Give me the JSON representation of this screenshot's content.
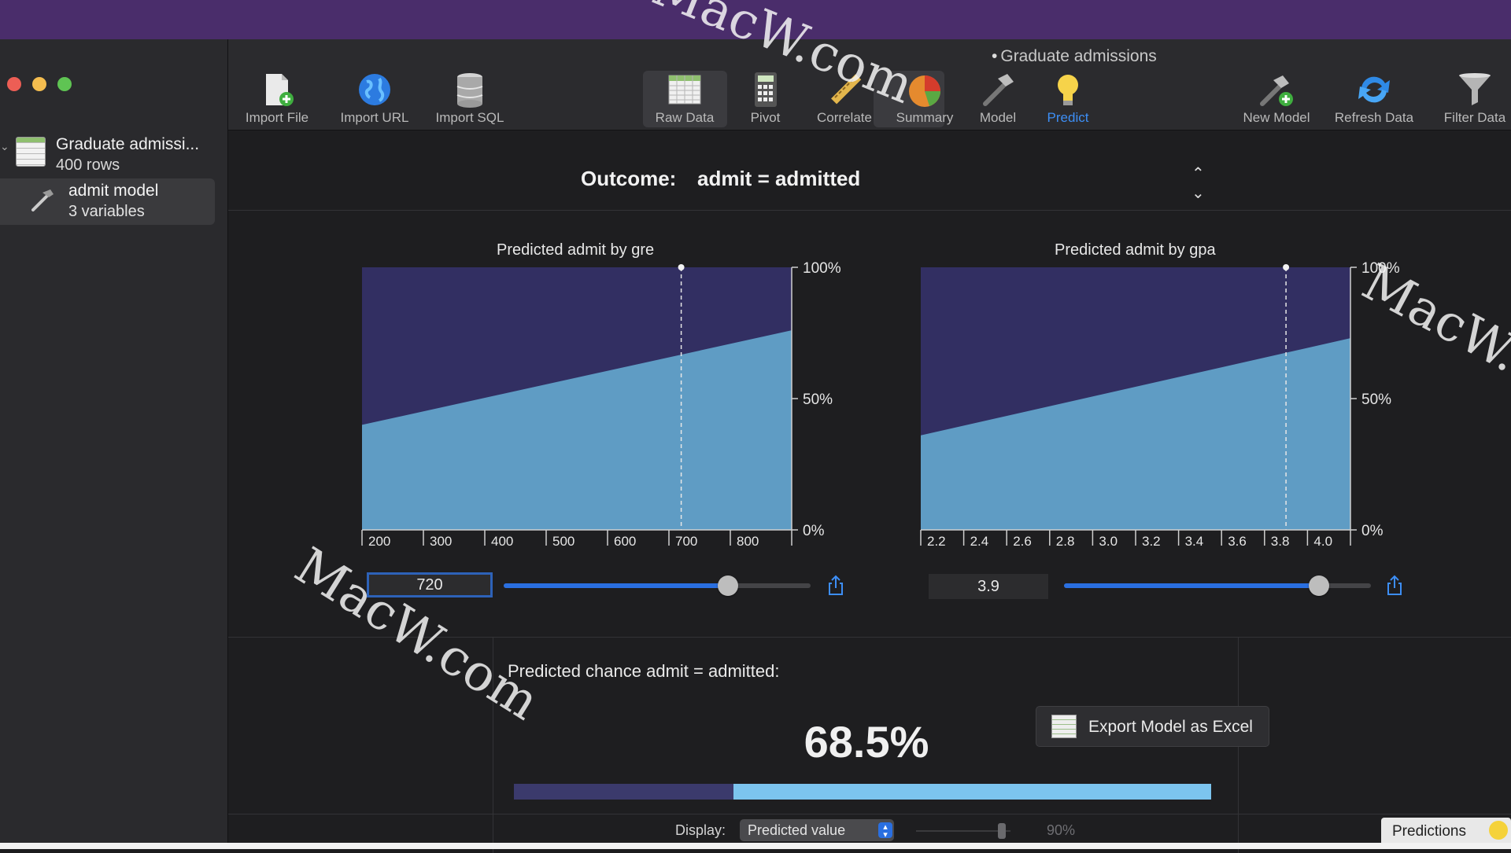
{
  "window": {
    "title": "Graduate admissions",
    "title_prefix": "•"
  },
  "sidebar": {
    "source": {
      "title": "Graduate admissi...",
      "subtitle": "400 rows"
    },
    "model": {
      "title": "admit model",
      "subtitle": "3 variables"
    }
  },
  "toolbar": {
    "import_file": "Import File",
    "import_url": "Import URL",
    "import_sql": "Import SQL",
    "raw_data": "Raw Data",
    "pivot": "Pivot",
    "correlate": "Correlate",
    "summary": "Summary",
    "model": "Model",
    "predict": "Predict",
    "new_model": "New Model",
    "refresh_data": "Refresh Data",
    "filter_data": "Filter Data",
    "active": "Predict"
  },
  "outcome": {
    "label": "Outcome:",
    "value": "admit = admitted"
  },
  "chart_data": [
    {
      "type": "area",
      "title": "Predicted admit by gre",
      "x_ticks": [
        200,
        300,
        400,
        500,
        600,
        700,
        800
      ],
      "x_tick_labels": [
        "200",
        "300",
        "400",
        "500",
        "600",
        "700",
        "800"
      ],
      "xlim": [
        200,
        900
      ],
      "y_ticks": [
        "0%",
        "50%",
        "100%"
      ],
      "ylim": [
        0,
        100
      ],
      "x": [
        200,
        900
      ],
      "y": [
        40,
        76
      ],
      "marker_x": 720,
      "colors": {
        "predicted": "#5f9cc4",
        "remainder": "#322f62"
      }
    },
    {
      "type": "area",
      "title": "Predicted admit by gpa",
      "x_ticks": [
        2.2,
        2.4,
        2.6,
        2.8,
        3.0,
        3.2,
        3.4,
        3.6,
        3.8,
        4.0
      ],
      "x_tick_labels": [
        "2.2",
        "2.4",
        "2.6",
        "2.8",
        "3.0",
        "3.2",
        "3.4",
        "3.6",
        "3.8",
        "4.0"
      ],
      "xlim": [
        2.2,
        4.2
      ],
      "y_ticks": [
        "0%",
        "50%",
        "100%"
      ],
      "ylim": [
        0,
        100
      ],
      "x": [
        2.2,
        4.2
      ],
      "y": [
        36,
        73
      ],
      "marker_x": 3.9,
      "colors": {
        "predicted": "#5f9cc4",
        "remainder": "#322f62"
      }
    }
  ],
  "controls": {
    "gre": {
      "value": "720",
      "slider_fraction": 0.73
    },
    "gpa": {
      "value": "3.9",
      "slider_fraction": 0.83
    }
  },
  "prediction": {
    "title": "Predicted chance admit = admitted:",
    "value_text": "68.5%",
    "value": 0.685,
    "bar_colors": {
      "negative": "#3b3a6c",
      "positive": "#7cc4ee"
    }
  },
  "export": {
    "label": "Export Model as Excel"
  },
  "display": {
    "label": "Display:",
    "selected": "Predicted value",
    "confidence": "90%",
    "predictions_tab": "Predictions"
  },
  "watermark": "MacW.com"
}
